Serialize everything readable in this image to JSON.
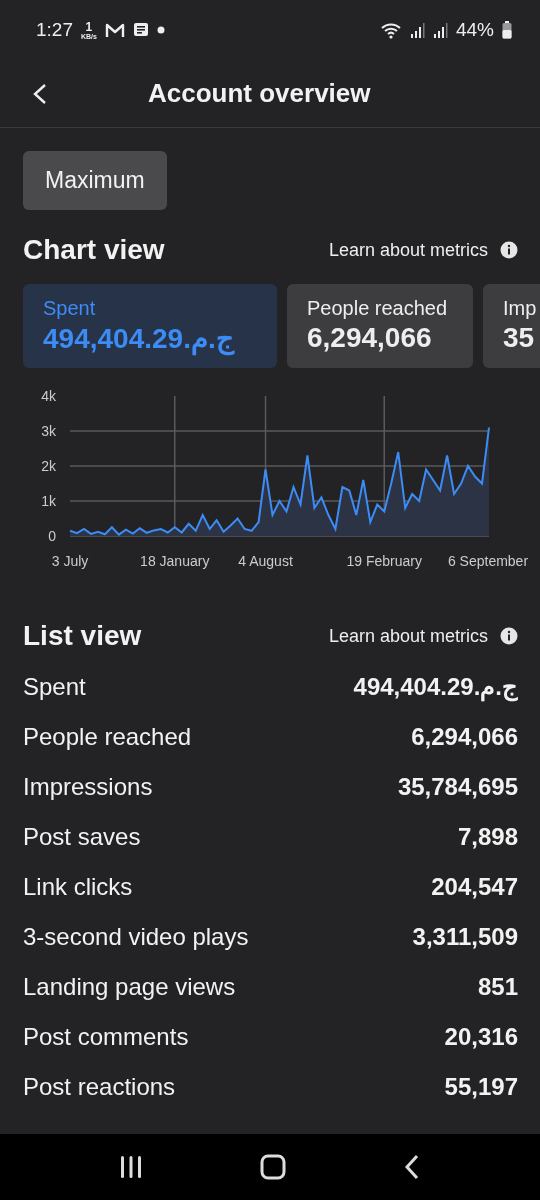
{
  "status_bar": {
    "time": "1:27",
    "data_rate_value": "1",
    "data_rate_unit": "KB/s",
    "battery": "44%"
  },
  "header": {
    "title": "Account overview"
  },
  "date_range": {
    "label": "Maximum"
  },
  "chart_view": {
    "title": "Chart view",
    "learn_link": "Learn about metrics",
    "metric_cards": [
      {
        "label": "Spent",
        "value": "494,404.29.ج.م",
        "selected": true
      },
      {
        "label": "People reached",
        "value": "6,294,066",
        "selected": false
      },
      {
        "label": "Imp",
        "value": "35",
        "selected": false
      }
    ],
    "chart_data": {
      "type": "area",
      "grid": true,
      "categories": [
        "3 July",
        null,
        null,
        null,
        null,
        null,
        null,
        null,
        null,
        null,
        null,
        null,
        null,
        null,
        null,
        "18 January",
        null,
        null,
        null,
        null,
        null,
        null,
        null,
        null,
        null,
        null,
        null,
        null,
        "4 August",
        null,
        null,
        null,
        null,
        null,
        null,
        null,
        null,
        null,
        null,
        null,
        null,
        null,
        null,
        null,
        null,
        "19 February",
        null,
        null,
        null,
        null,
        null,
        null,
        null,
        null,
        null,
        null,
        null,
        null,
        null,
        null,
        "6 September"
      ],
      "values": [
        150,
        80,
        200,
        60,
        120,
        50,
        250,
        40,
        180,
        70,
        220,
        90,
        160,
        200,
        100,
        250,
        100,
        350,
        150,
        600,
        200,
        450,
        120,
        300,
        500,
        200,
        150,
        400,
        1900,
        600,
        1000,
        700,
        1400,
        900,
        2300,
        800,
        1100,
        600,
        200,
        1400,
        1300,
        600,
        1600,
        400,
        900,
        700,
        1500,
        2400,
        800,
        1200,
        1000,
        1900,
        1600,
        1300,
        2300,
        1200,
        1500,
        2000,
        1700,
        1500,
        3100
      ],
      "ylim": [
        0,
        4000
      ],
      "yticks": [
        {
          "value": 0,
          "label": "0"
        },
        {
          "value": 1000,
          "label": "1k"
        },
        {
          "value": 2000,
          "label": "2k"
        },
        {
          "value": 3000,
          "label": "3k"
        },
        {
          "value": 4000,
          "label": "4k"
        }
      ]
    }
  },
  "list_view": {
    "title": "List view",
    "learn_link": "Learn about metrics",
    "rows": [
      {
        "name": "Spent",
        "value": "494,404.29.ج.م"
      },
      {
        "name": "People reached",
        "value": "6,294,066"
      },
      {
        "name": "Impressions",
        "value": "35,784,695"
      },
      {
        "name": "Post saves",
        "value": "7,898"
      },
      {
        "name": "Link clicks",
        "value": "204,547"
      },
      {
        "name": "3-second video plays",
        "value": "3,311,509"
      },
      {
        "name": "Landing page views",
        "value": "851"
      },
      {
        "name": "Post comments",
        "value": "20,316"
      },
      {
        "name": "Post reactions",
        "value": "55,197"
      }
    ]
  }
}
